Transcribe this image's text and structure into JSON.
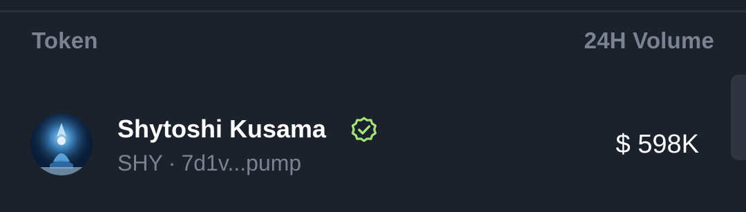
{
  "table": {
    "headers": {
      "token": "Token",
      "volume": "24H Volume"
    },
    "rows": [
      {
        "name": "Shytoshi Kusama",
        "symbol": "SHY",
        "separator": "·",
        "address": "7d1v...pump",
        "volume": "$ 598K",
        "verified": true,
        "verified_icon": "verified-badge-icon",
        "verified_color": "#a6e37a"
      }
    ]
  },
  "colors": {
    "background": "#1c222c",
    "muted_text": "#7a8391",
    "primary_text": "#ffffff",
    "verified": "#a6e37a"
  }
}
